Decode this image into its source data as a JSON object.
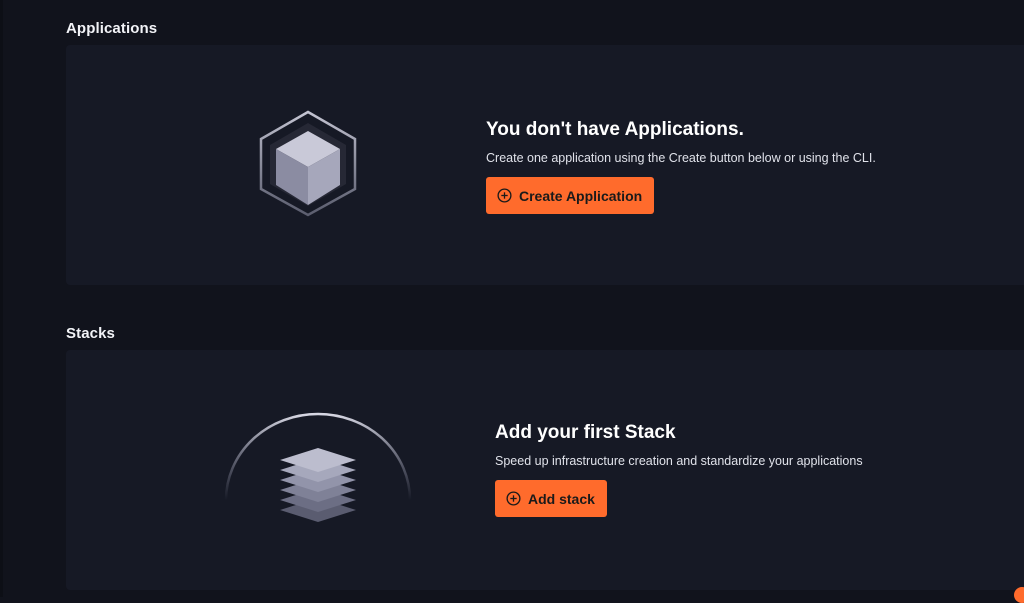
{
  "applications": {
    "section_title": "Applications",
    "empty_heading": "You don't have Applications.",
    "empty_description": "Create one application using the Create button below or using the CLI.",
    "create_button_label": "Create Application",
    "illustration_icon": "cube-icon"
  },
  "stacks": {
    "section_title": "Stacks",
    "empty_heading": "Add your first Stack",
    "empty_description": "Speed up infrastructure creation and standardize your applications",
    "add_button_label": "Add stack",
    "illustration_icon": "stacked-layers-icon"
  },
  "colors": {
    "background": "#11131c",
    "panel": "#161925",
    "accent": "#ff6b2c"
  }
}
